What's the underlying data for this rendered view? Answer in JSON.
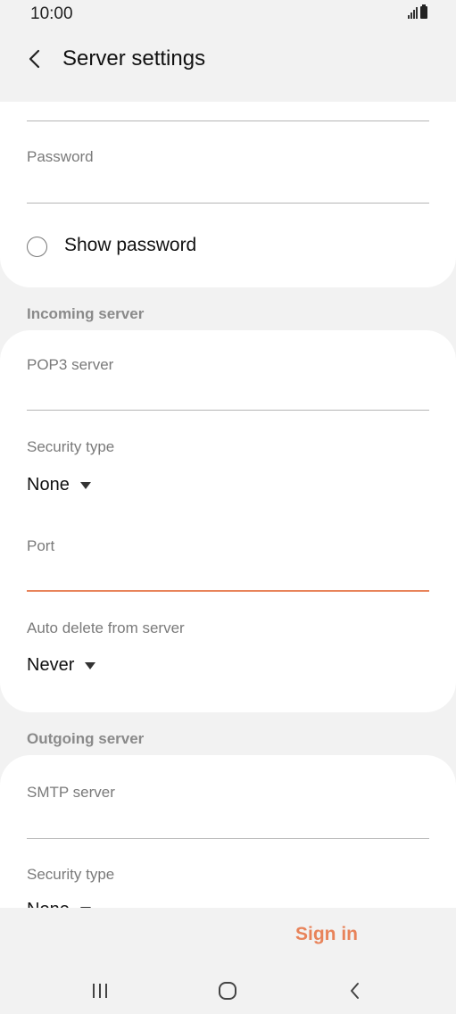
{
  "status_bar": {
    "time": "10:00",
    "signal_icon": "signal-icon",
    "battery_icon": "battery-icon"
  },
  "header": {
    "title": "Server settings",
    "back_icon": "back-arrow-icon"
  },
  "account": {
    "password_label": "Password",
    "password_value": "",
    "show_password_label": "Show password",
    "show_password_checked": false
  },
  "incoming": {
    "section_title": "Incoming server",
    "pop3_label": "POP3 server",
    "pop3_value": "",
    "security_label": "Security type",
    "security_value": "None",
    "port_label": "Port",
    "port_value": "",
    "auto_delete_label": "Auto delete from server",
    "auto_delete_value": "Never"
  },
  "outgoing": {
    "section_title": "Outgoing server",
    "smtp_label": "SMTP server",
    "smtp_value": "",
    "security_label": "Security type",
    "security_value": "None"
  },
  "actions": {
    "sign_in_label": "Sign in"
  },
  "accent_color": "#e8835a",
  "nav_bar": {
    "recents_icon": "recents-icon",
    "home_icon": "home-icon",
    "back_icon": "nav-back-icon"
  }
}
